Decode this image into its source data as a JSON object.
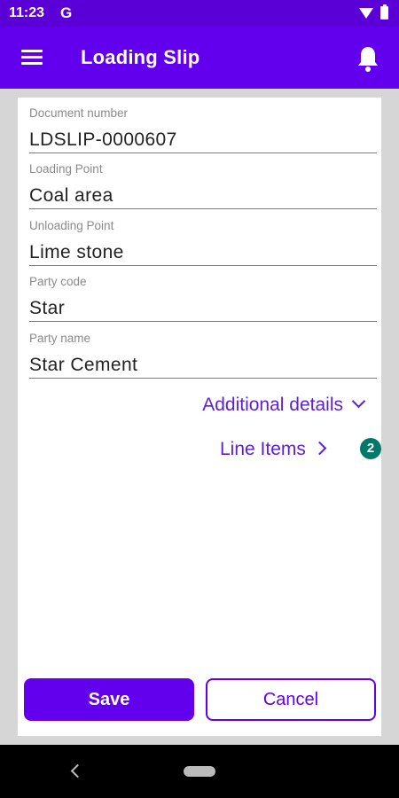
{
  "status_bar": {
    "time": "11:23",
    "g_label": "G"
  },
  "app_bar": {
    "title": "Loading Slip",
    "menu_icon": "menu-icon",
    "notification_icon": "bell-icon"
  },
  "form": {
    "fields": [
      {
        "label": "Document number",
        "value": "LDSLIP-0000607"
      },
      {
        "label": "Loading Point",
        "value": "Coal area"
      },
      {
        "label": "Unloading Point",
        "value": "Lime stone"
      },
      {
        "label": "Party code",
        "value": "Star"
      },
      {
        "label": "Party name",
        "value": "Star Cement"
      }
    ],
    "additional_details_label": "Additional details",
    "line_items_label": "Line Items",
    "line_items_count": "2"
  },
  "buttons": {
    "save_label": "Save",
    "cancel_label": "Cancel"
  },
  "colors": {
    "primary": "#6200ee",
    "status_bar": "#5a00d6",
    "badge": "#00796b",
    "link": "#5b1fd8"
  }
}
